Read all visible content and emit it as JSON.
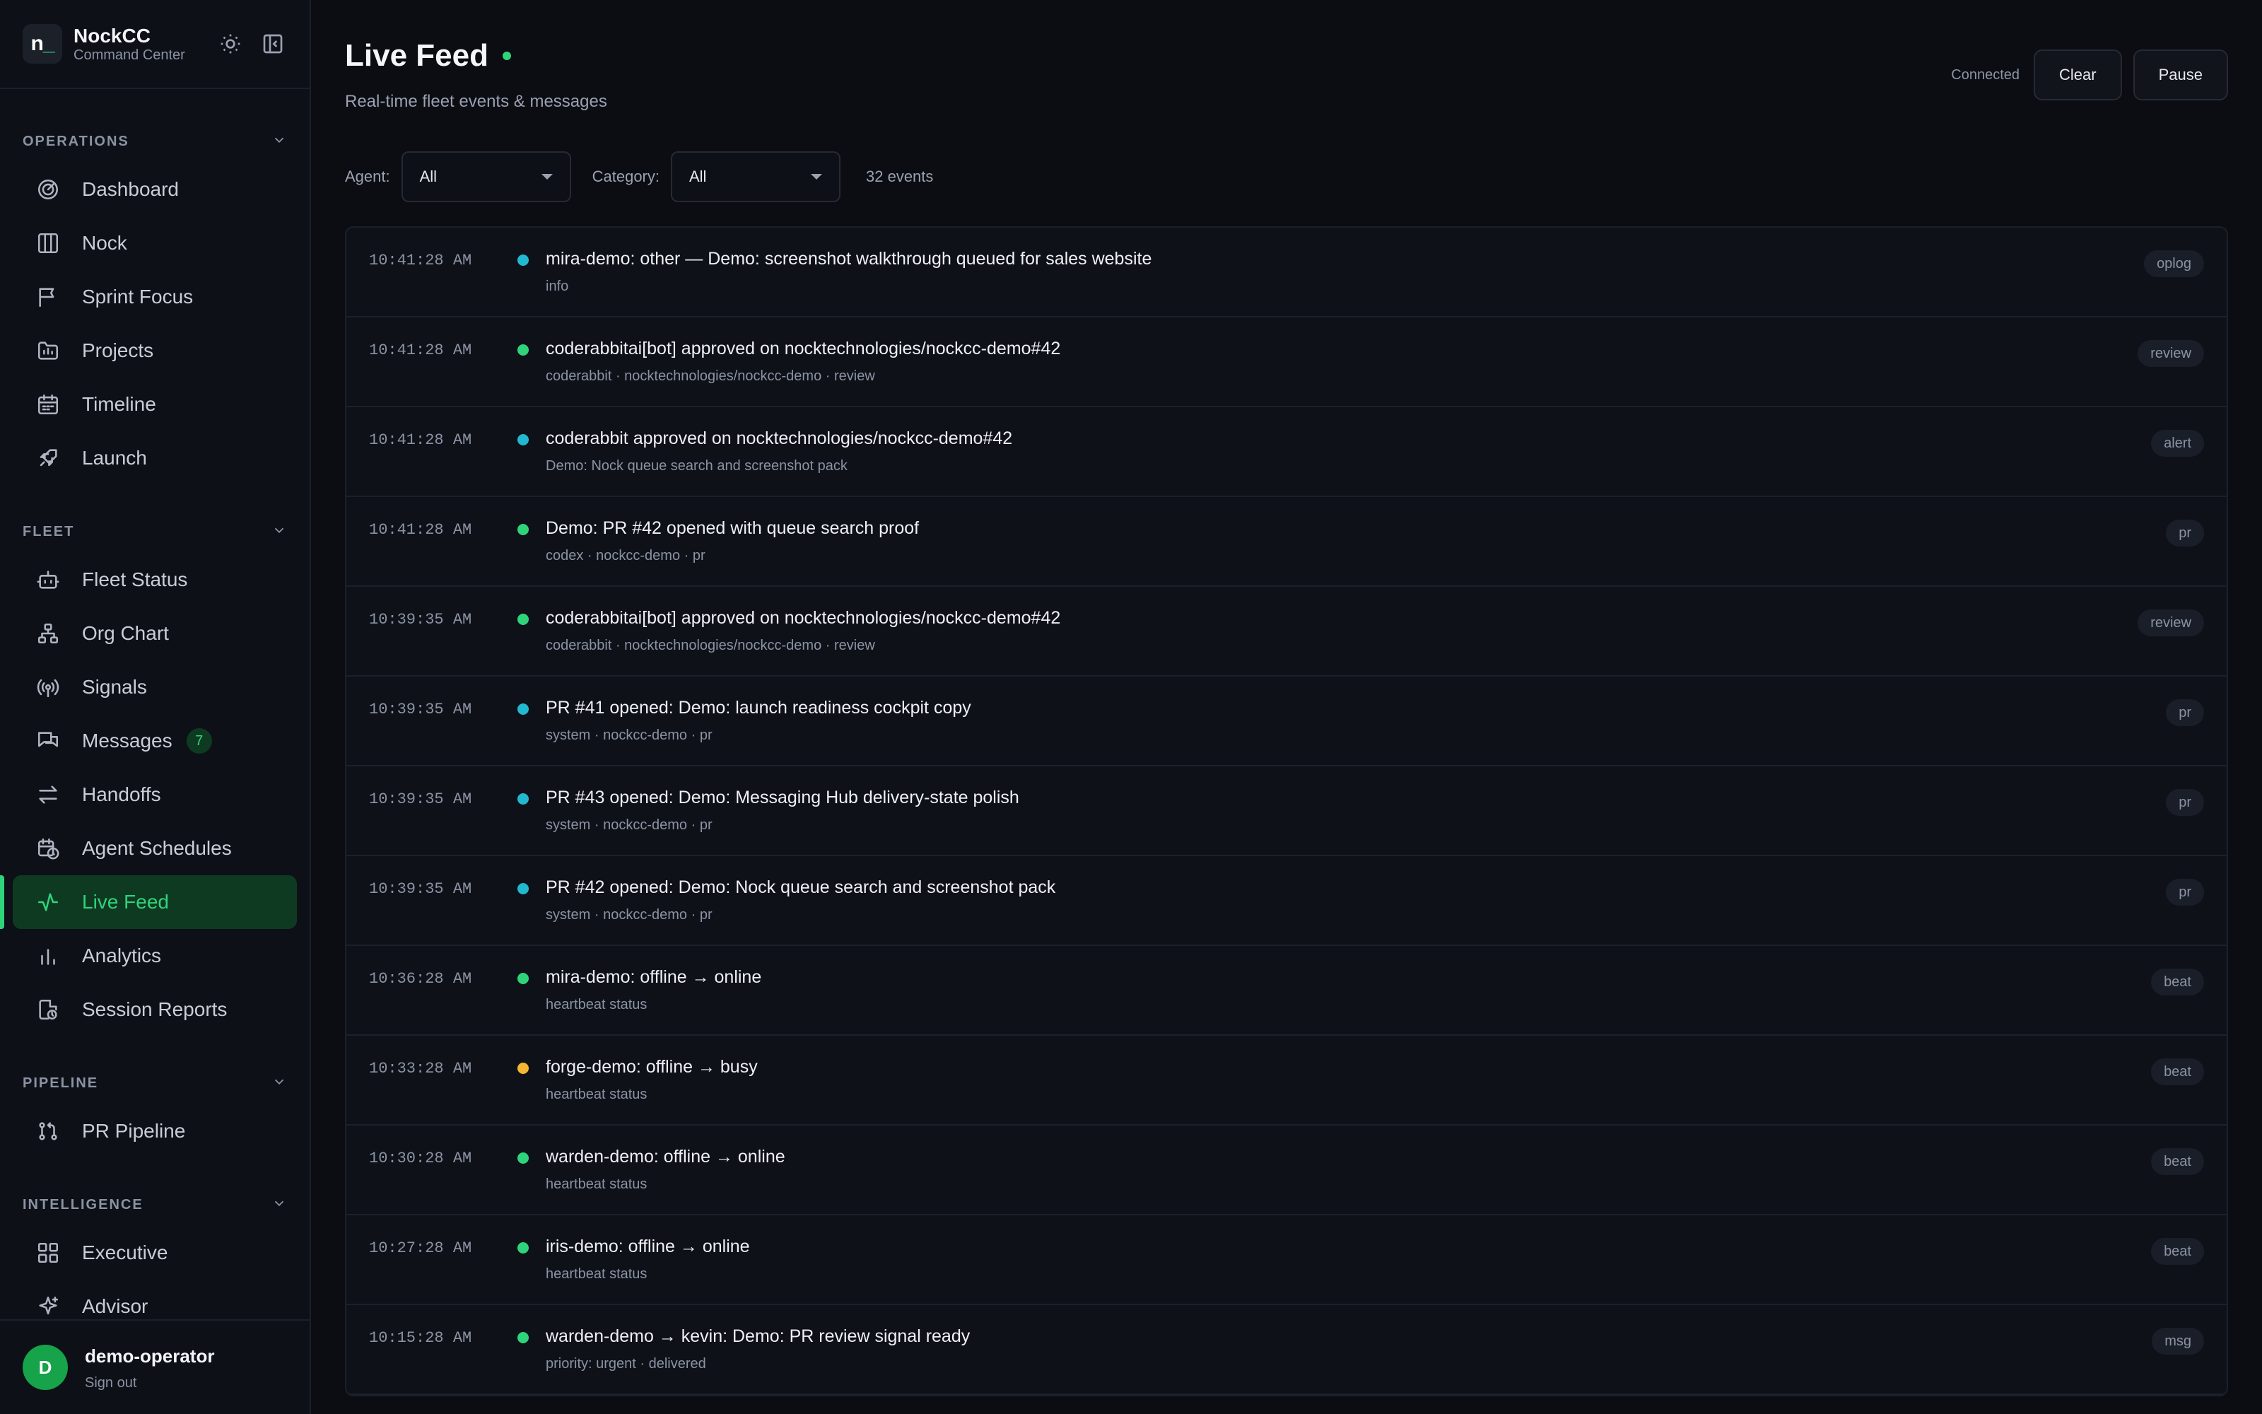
{
  "brand": {
    "logo_text": "n_",
    "title": "NockCC",
    "subtitle": "Command Center"
  },
  "sidebar": {
    "sections": [
      {
        "label": "OPERATIONS",
        "items": [
          {
            "label": "Dashboard",
            "icon": "radar-icon"
          },
          {
            "label": "Nock",
            "icon": "board-icon"
          },
          {
            "label": "Sprint Focus",
            "icon": "flag-icon"
          },
          {
            "label": "Projects",
            "icon": "folder-icon"
          },
          {
            "label": "Timeline",
            "icon": "calendar-icon"
          },
          {
            "label": "Launch",
            "icon": "rocket-icon"
          }
        ]
      },
      {
        "label": "FLEET",
        "items": [
          {
            "label": "Fleet Status",
            "icon": "bot-icon"
          },
          {
            "label": "Org Chart",
            "icon": "network-icon"
          },
          {
            "label": "Signals",
            "icon": "antenna-icon"
          },
          {
            "label": "Messages",
            "icon": "chat-icon",
            "badge": "7"
          },
          {
            "label": "Handoffs",
            "icon": "arrows-icon"
          },
          {
            "label": "Agent Schedules",
            "icon": "calendar-clock-icon"
          },
          {
            "label": "Live Feed",
            "icon": "activity-icon",
            "active": true
          },
          {
            "label": "Analytics",
            "icon": "bar-chart-icon"
          },
          {
            "label": "Session Reports",
            "icon": "report-icon"
          }
        ]
      },
      {
        "label": "PIPELINE",
        "items": [
          {
            "label": "PR Pipeline",
            "icon": "git-pull-icon"
          }
        ]
      },
      {
        "label": "INTELLIGENCE",
        "items": [
          {
            "label": "Executive",
            "icon": "layout-icon"
          },
          {
            "label": "Advisor",
            "icon": "sparkles-icon"
          }
        ]
      }
    ]
  },
  "user": {
    "initial": "D",
    "name": "demo-operator",
    "sign_out": "Sign out"
  },
  "header": {
    "title": "Live Feed",
    "subtitle": "Real-time fleet events & messages",
    "status": "Connected",
    "clear_label": "Clear",
    "pause_label": "Pause"
  },
  "filters": {
    "agent_label": "Agent:",
    "agent_value": "All",
    "category_label": "Category:",
    "category_value": "All",
    "count": "32 events"
  },
  "colors": {
    "accent": "#2fd47a",
    "teal": "#22b8cf",
    "amber": "#f5b731"
  },
  "events": [
    {
      "time": "10:41:28 AM",
      "dot": "#22b8cf",
      "title": "mira-demo: other — Demo: screenshot walkthrough queued for sales website",
      "meta": "info",
      "tag": "oplog"
    },
    {
      "time": "10:41:28 AM",
      "dot": "#2fd47a",
      "title": "coderabbitai[bot] approved on nocktechnologies/nockcc-demo#42",
      "meta": "coderabbit · nocktechnologies/nockcc-demo · review",
      "tag": "review"
    },
    {
      "time": "10:41:28 AM",
      "dot": "#22b8cf",
      "title": "coderabbit approved on nocktechnologies/nockcc-demo#42",
      "meta": "Demo: Nock queue search and screenshot pack",
      "tag": "alert"
    },
    {
      "time": "10:41:28 AM",
      "dot": "#2fd47a",
      "title": "Demo: PR #42 opened with queue search proof",
      "meta": "codex · nockcc-demo · pr",
      "tag": "pr"
    },
    {
      "time": "10:39:35 AM",
      "dot": "#2fd47a",
      "title": "coderabbitai[bot] approved on nocktechnologies/nockcc-demo#42",
      "meta": "coderabbit · nocktechnologies/nockcc-demo · review",
      "tag": "review"
    },
    {
      "time": "10:39:35 AM",
      "dot": "#22b8cf",
      "title": "PR #41 opened: Demo: launch readiness cockpit copy",
      "meta": "system · nockcc-demo · pr",
      "tag": "pr"
    },
    {
      "time": "10:39:35 AM",
      "dot": "#22b8cf",
      "title": "PR #43 opened: Demo: Messaging Hub delivery-state polish",
      "meta": "system · nockcc-demo · pr",
      "tag": "pr"
    },
    {
      "time": "10:39:35 AM",
      "dot": "#22b8cf",
      "title": "PR #42 opened: Demo: Nock queue search and screenshot pack",
      "meta": "system · nockcc-demo · pr",
      "tag": "pr"
    },
    {
      "time": "10:36:28 AM",
      "dot": "#2fd47a",
      "title": "mira-demo: offline → online",
      "meta": "heartbeat status",
      "tag": "beat"
    },
    {
      "time": "10:33:28 AM",
      "dot": "#f5b731",
      "title": "forge-demo: offline → busy",
      "meta": "heartbeat status",
      "tag": "beat"
    },
    {
      "time": "10:30:28 AM",
      "dot": "#2fd47a",
      "title": "warden-demo: offline → online",
      "meta": "heartbeat status",
      "tag": "beat"
    },
    {
      "time": "10:27:28 AM",
      "dot": "#2fd47a",
      "title": "iris-demo: offline → online",
      "meta": "heartbeat status",
      "tag": "beat"
    },
    {
      "time": "10:15:28 AM",
      "dot": "#2fd47a",
      "title": "warden-demo → kevin: Demo: PR review signal ready",
      "meta": "priority: urgent · delivered",
      "tag": "msg"
    }
  ]
}
